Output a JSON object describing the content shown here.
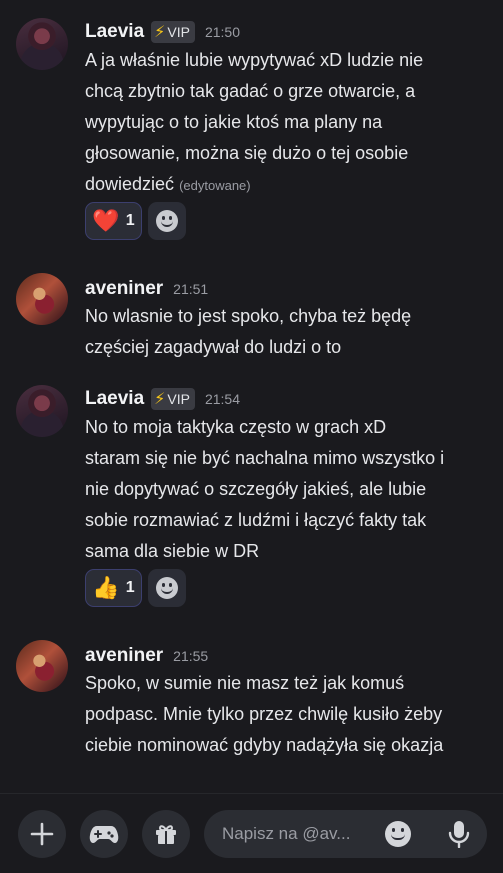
{
  "messages": [
    {
      "username": "Laevia",
      "badge": "VIP",
      "time": "21:50",
      "lines": [
        "A ja właśnie lubie wypytywać xD ludzie nie",
        "chcą zbytnio tak gadać o grze otwarcie, a",
        "wypytując o to jakie ktoś ma plany na",
        "głosowanie, można się dużo o tej osobie",
        "dowiedzieć"
      ],
      "edited": "(edytowane)",
      "reaction": {
        "emoji": "❤️",
        "count": "1",
        "emoji_name": "heart"
      }
    },
    {
      "username": "aveniner",
      "time": "21:51",
      "lines": [
        "No wlasnie to jest spoko, chyba też będę",
        "częściej zagadywał do ludzi o to"
      ]
    },
    {
      "username": "Laevia",
      "badge": "VIP",
      "time": "21:54",
      "lines": [
        "No to moja taktyka często w grach xD",
        "staram się nie być nachalna mimo wszystko i",
        "nie dopytywać o szczegóły jakieś, ale lubie",
        "sobie rozmawiać z ludźmi i łączyć fakty tak",
        "sama dla siebie w DR"
      ],
      "reaction": {
        "emoji": "👍",
        "count": "1",
        "emoji_name": "thumbs-up"
      }
    },
    {
      "username": "aveniner",
      "time": "21:55",
      "lines": [
        "Spoko, w sumie nie masz też jak komuś",
        "podpasc. Mnie tylko przez chwilę kusiło żeby",
        "ciebie nominować gdyby nadążyła się okazja"
      ]
    }
  ],
  "composer": {
    "placeholder": "Napisz na @av...",
    "icons": [
      "plus-icon",
      "gamepad-icon",
      "gift-icon",
      "emoji-icon",
      "microphone-icon"
    ]
  },
  "colors": {
    "background": "#1a1a1e",
    "reaction_border": "#3c3f6e",
    "vip_bolt": "#f5c518"
  }
}
